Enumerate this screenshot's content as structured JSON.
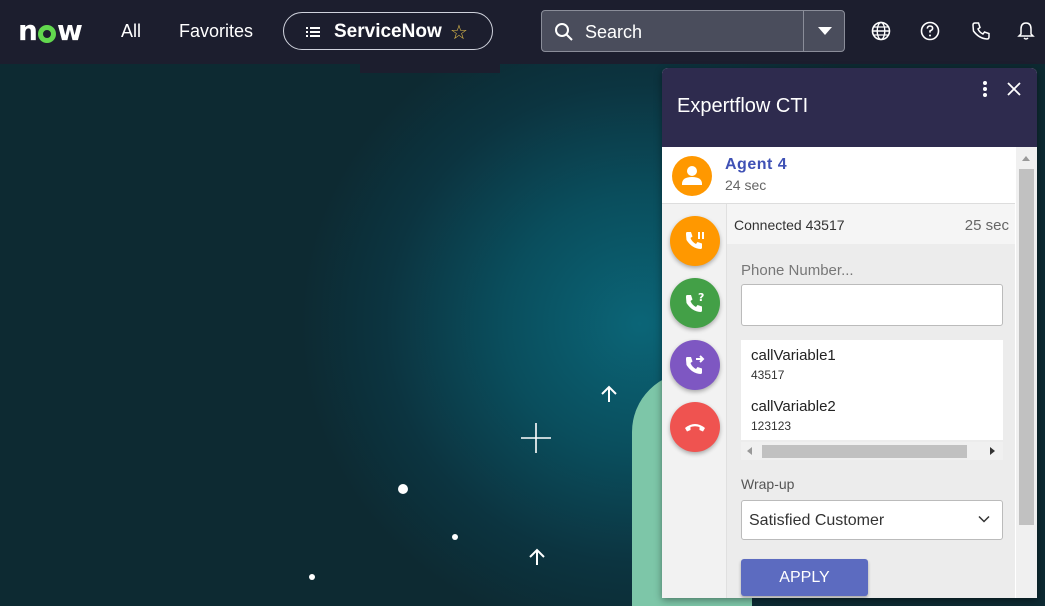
{
  "topbar": {
    "logo_text": "now",
    "nav_all": "All",
    "nav_favorites": "Favorites",
    "app_pill_label": "ServiceNow",
    "search_placeholder": "Search",
    "icons": [
      "globe-icon",
      "help-icon",
      "phone-icon",
      "bell-icon"
    ]
  },
  "cti": {
    "title": "Expertflow CTI",
    "agent": {
      "name": "Agent  4",
      "time": "24 sec"
    },
    "call": {
      "status": "Connected 43517",
      "duration": "25 sec"
    },
    "actions": [
      {
        "name": "hold-call-button",
        "icon": "phone-pause-icon",
        "color": "#ff9800"
      },
      {
        "name": "consult-call-button",
        "icon": "phone-question-icon",
        "color": "#43a047"
      },
      {
        "name": "transfer-call-button",
        "icon": "phone-forward-icon",
        "color": "#7e57c2"
      },
      {
        "name": "end-call-button",
        "icon": "phone-hangup-icon",
        "color": "#ef5350"
      }
    ],
    "phone_label": "Phone Number...",
    "phone_value": "",
    "call_variables": [
      {
        "key": "callVariable1",
        "value": "43517"
      },
      {
        "key": "callVariable2",
        "value": "123123"
      }
    ],
    "wrapup_label": "Wrap-up",
    "wrapup_value": "Satisfied Customer",
    "apply_label": "APPLY"
  },
  "colors": {
    "topbar_bg": "#1c1e2e",
    "cti_header_bg": "#2e2b4e",
    "agent_name": "#3f51b5",
    "apply_button": "#5c6bc0",
    "logo_accent": "#62d84e"
  }
}
